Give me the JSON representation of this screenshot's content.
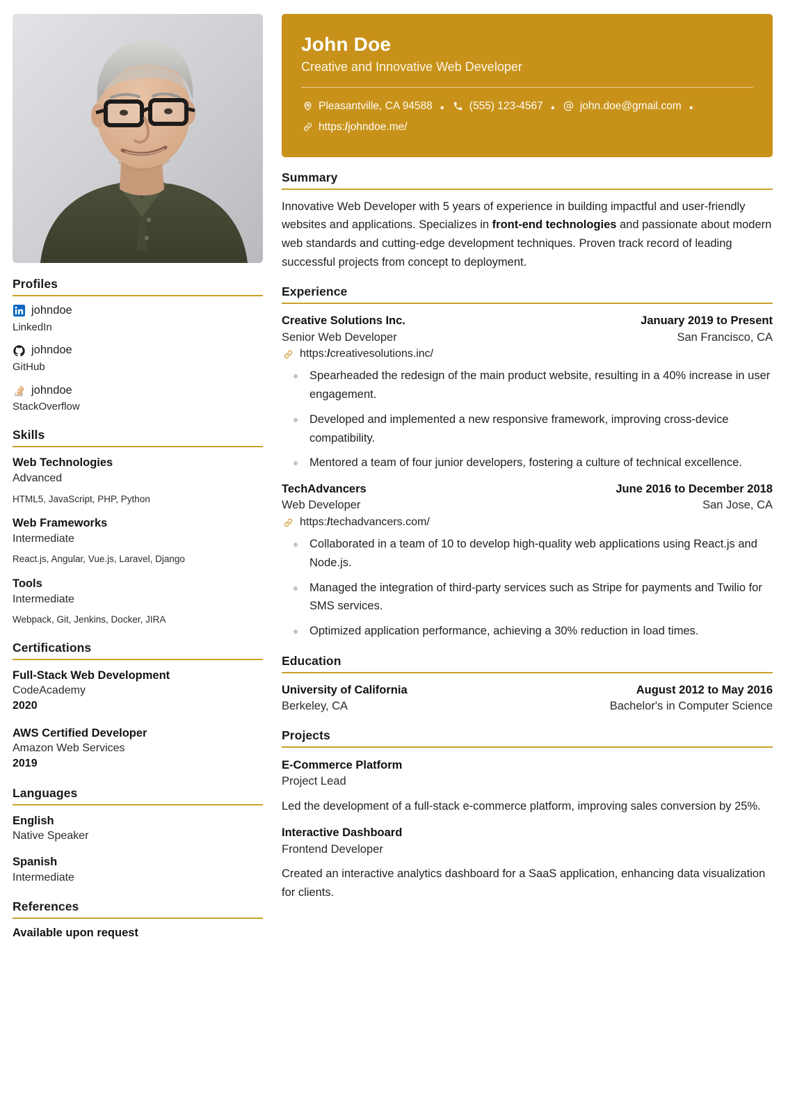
{
  "theme": {
    "accent": "#c8921a",
    "rule": "#c9a227",
    "banner_text": "#ffffff",
    "body_text": "#222222",
    "bullet_marker": "#c3c3c3",
    "linkedin_blue": "#0a66c2",
    "github_dark": "#1b1f23",
    "stackoverflow_orange": "#d4873a"
  },
  "header": {
    "name": "John Doe",
    "label": "Creative and Innovative Web Developer",
    "separator": "•",
    "contacts": [
      {
        "icon": "location-pin-icon",
        "text": "Pleasantville, CA 94588"
      },
      {
        "icon": "phone-icon",
        "text": "(555) 123-4567"
      },
      {
        "icon": "at-sign-icon",
        "text": "john.doe@gmail.com"
      },
      {
        "icon": "link-icon",
        "text_prefix": "https:",
        "text_slash": "/",
        "text": "johndoe.me/"
      }
    ]
  },
  "photo": {
    "alt": "profile-photo",
    "description": "Headshot of a smiling man with grey hair, black-framed glasses, wearing a dark olive polo shirt on a grey studio background"
  },
  "sidebar": {
    "profiles": {
      "heading": "Profiles",
      "items": [
        {
          "icon": "linkedin-icon",
          "username": "johndoe",
          "network": "LinkedIn"
        },
        {
          "icon": "github-icon",
          "username": "johndoe",
          "network": "GitHub"
        },
        {
          "icon": "stackoverflow-icon",
          "username": "johndoe",
          "network": "StackOverflow"
        }
      ]
    },
    "skills": {
      "heading": "Skills",
      "items": [
        {
          "name": "Web Technologies",
          "level": "Advanced",
          "keywords": "HTML5, JavaScript, PHP, Python"
        },
        {
          "name": "Web Frameworks",
          "level": "Intermediate",
          "keywords": "React.js, Angular, Vue.js, Laravel, Django"
        },
        {
          "name": "Tools",
          "level": "Intermediate",
          "keywords": "Webpack, Git, Jenkins, Docker, JIRA"
        }
      ]
    },
    "certifications": {
      "heading": "Certifications",
      "items": [
        {
          "name": "Full-Stack Web Development",
          "issuer": "CodeAcademy",
          "date": "2020"
        },
        {
          "name": "AWS Certified Developer",
          "issuer": "Amazon Web Services",
          "date": "2019"
        }
      ]
    },
    "languages": {
      "heading": "Languages",
      "items": [
        {
          "language": "English",
          "fluency": "Native Speaker"
        },
        {
          "language": "Spanish",
          "fluency": "Intermediate"
        }
      ]
    },
    "references": {
      "heading": "References",
      "text": "Available upon request"
    }
  },
  "main": {
    "summary": {
      "heading": "Summary",
      "text_before": "Innovative Web Developer with 5 years of experience in building impactful and user-friendly websites and applications. Specializes in ",
      "bold": "front-end technologies",
      "text_after": " and passionate about modern web standards and cutting-edge development techniques. Proven track record of leading successful projects from concept to deployment."
    },
    "experience": {
      "heading": "Experience",
      "items": [
        {
          "org": "Creative Solutions Inc.",
          "date": "January 2019 to Present",
          "position": "Senior Web Developer",
          "location": "San Francisco, CA",
          "url_prefix": "https:",
          "url_slash": "/",
          "url": "creativesolutions.inc/",
          "highlights": [
            "Spearheaded the redesign of the main product website, resulting in a 40% increase in user engagement.",
            "Developed and implemented a new responsive framework, improving cross-device compatibility.",
            "Mentored a team of four junior developers, fostering a culture of technical excellence."
          ]
        },
        {
          "org": "TechAdvancers",
          "date": "June 2016 to December 2018",
          "position": "Web Developer",
          "location": "San Jose, CA",
          "url_prefix": "https:",
          "url_slash": "/",
          "url": "techadvancers.com/",
          "highlights": [
            "Collaborated in a team of 10 to develop high-quality web applications using React.js and Node.js.",
            "Managed the integration of third-party services such as Stripe for payments and Twilio for SMS services.",
            "Optimized application performance, achieving a 30% reduction in load times."
          ]
        }
      ]
    },
    "education": {
      "heading": "Education",
      "items": [
        {
          "institution": "University of California",
          "date": "August 2012 to May 2016",
          "location": "Berkeley, CA",
          "study": "Bachelor's in Computer Science"
        }
      ]
    },
    "projects": {
      "heading": "Projects",
      "items": [
        {
          "name": "E-Commerce Platform",
          "role": "Project Lead",
          "description": "Led the development of a full-stack e-commerce platform, improving sales conversion by 25%."
        },
        {
          "name": "Interactive Dashboard",
          "role": "Frontend Developer",
          "description": "Created an interactive analytics dashboard for a SaaS application, enhancing data visualization for clients."
        }
      ]
    }
  }
}
